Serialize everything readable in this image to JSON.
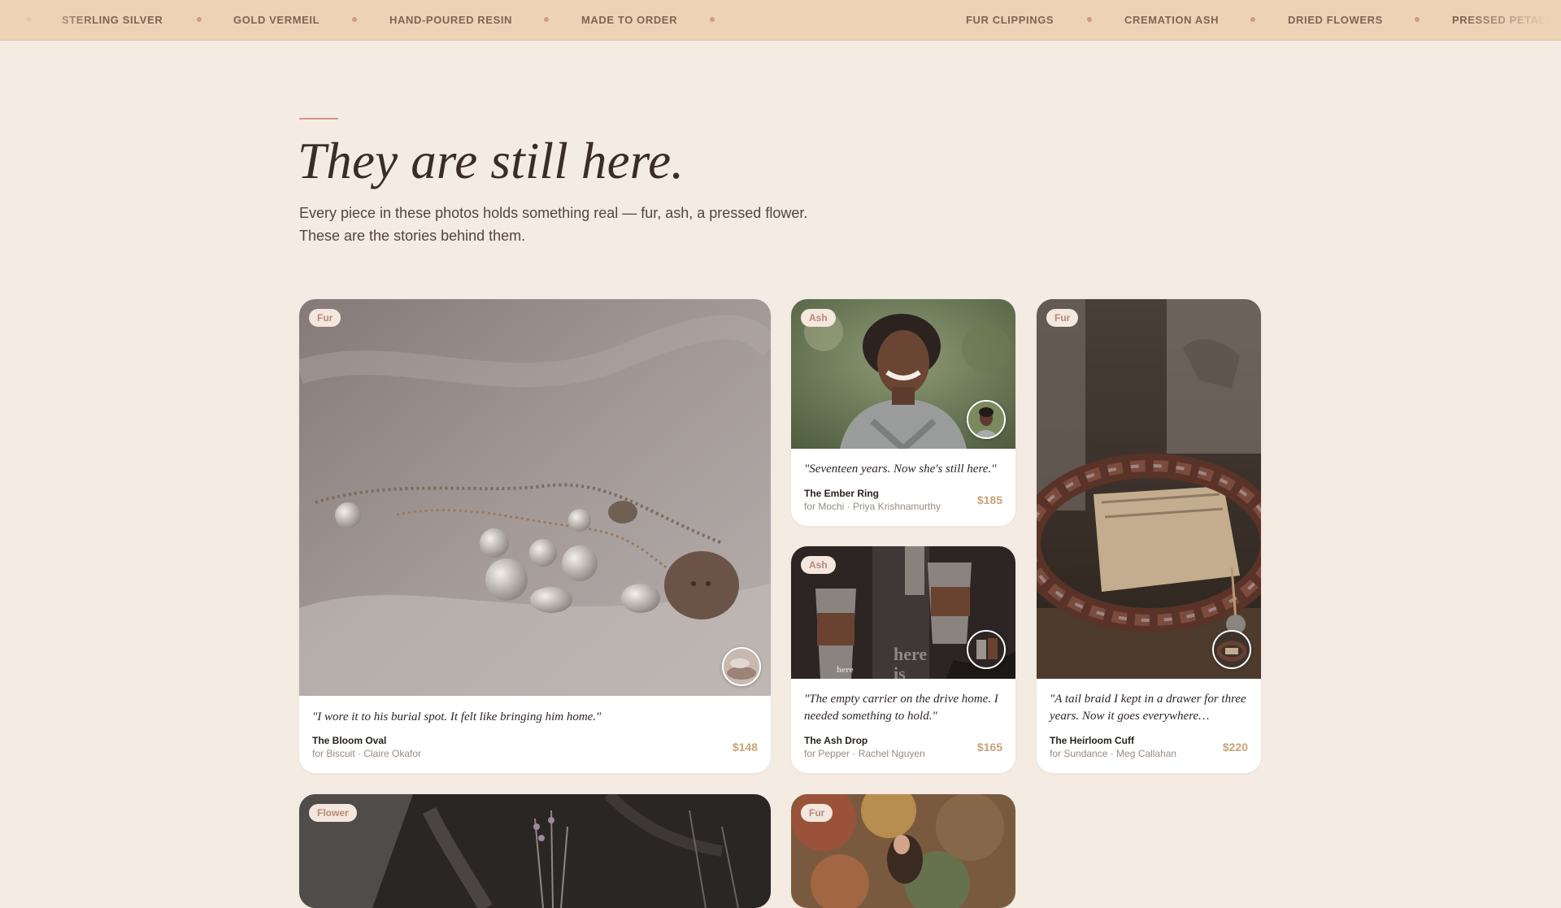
{
  "ticker": {
    "items": [
      "STERLING SILVER",
      "GOLD VERMEIL",
      "HAND-POURED RESIN",
      "MADE TO ORDER",
      "FUR CLIPPINGS",
      "CREMATION ASH",
      "DRIED FLOWERS",
      "PRESSED PETALS"
    ],
    "dot_color": "#d6968a"
  },
  "hero": {
    "title": "They are still here.",
    "intro_line1": "Every piece in these photos holds something real — fur, ash, a pressed flower.",
    "intro_line2": "These are the stories behind them."
  },
  "cards": [
    {
      "tag": "Fur",
      "quote": "\"I wore it to his burial spot. It felt like bringing him home.\"",
      "product": "The Bloom Oval",
      "meta": "for Biscuit · Claire Okafor",
      "price": "$148"
    },
    {
      "tag": "Ash",
      "quote": "\"Seventeen years. Now she's still here.\"",
      "product": "The Ember Ring",
      "meta": "for Mochi · Priya Krishnamurthy",
      "price": "$185"
    },
    {
      "tag": "Ash",
      "quote": "\"The empty carrier on the drive home. I needed something to hold.\"",
      "product": "The Ash Drop",
      "meta": "for Pepper · Rachel Nguyen",
      "price": "$165",
      "photo_text": [
        "here",
        "is",
        "here"
      ]
    },
    {
      "tag": "Fur",
      "quote": "\"A tail braid I kept in a drawer for three years. Now it goes everywhere…",
      "product": "The Heirloom Cuff",
      "meta": "for Sundance · Meg Callahan",
      "price": "$220"
    },
    {
      "tag": "Flower"
    },
    {
      "tag": "Fur"
    }
  ],
  "colors": {
    "background": "#f4ebe3",
    "ticker_bg": "#ecd3b6",
    "accent": "#d6968a",
    "price": "#c9a279",
    "tag_text": "#b8897a"
  },
  "icons": [
    "memorial-photo-thumbnail"
  ]
}
